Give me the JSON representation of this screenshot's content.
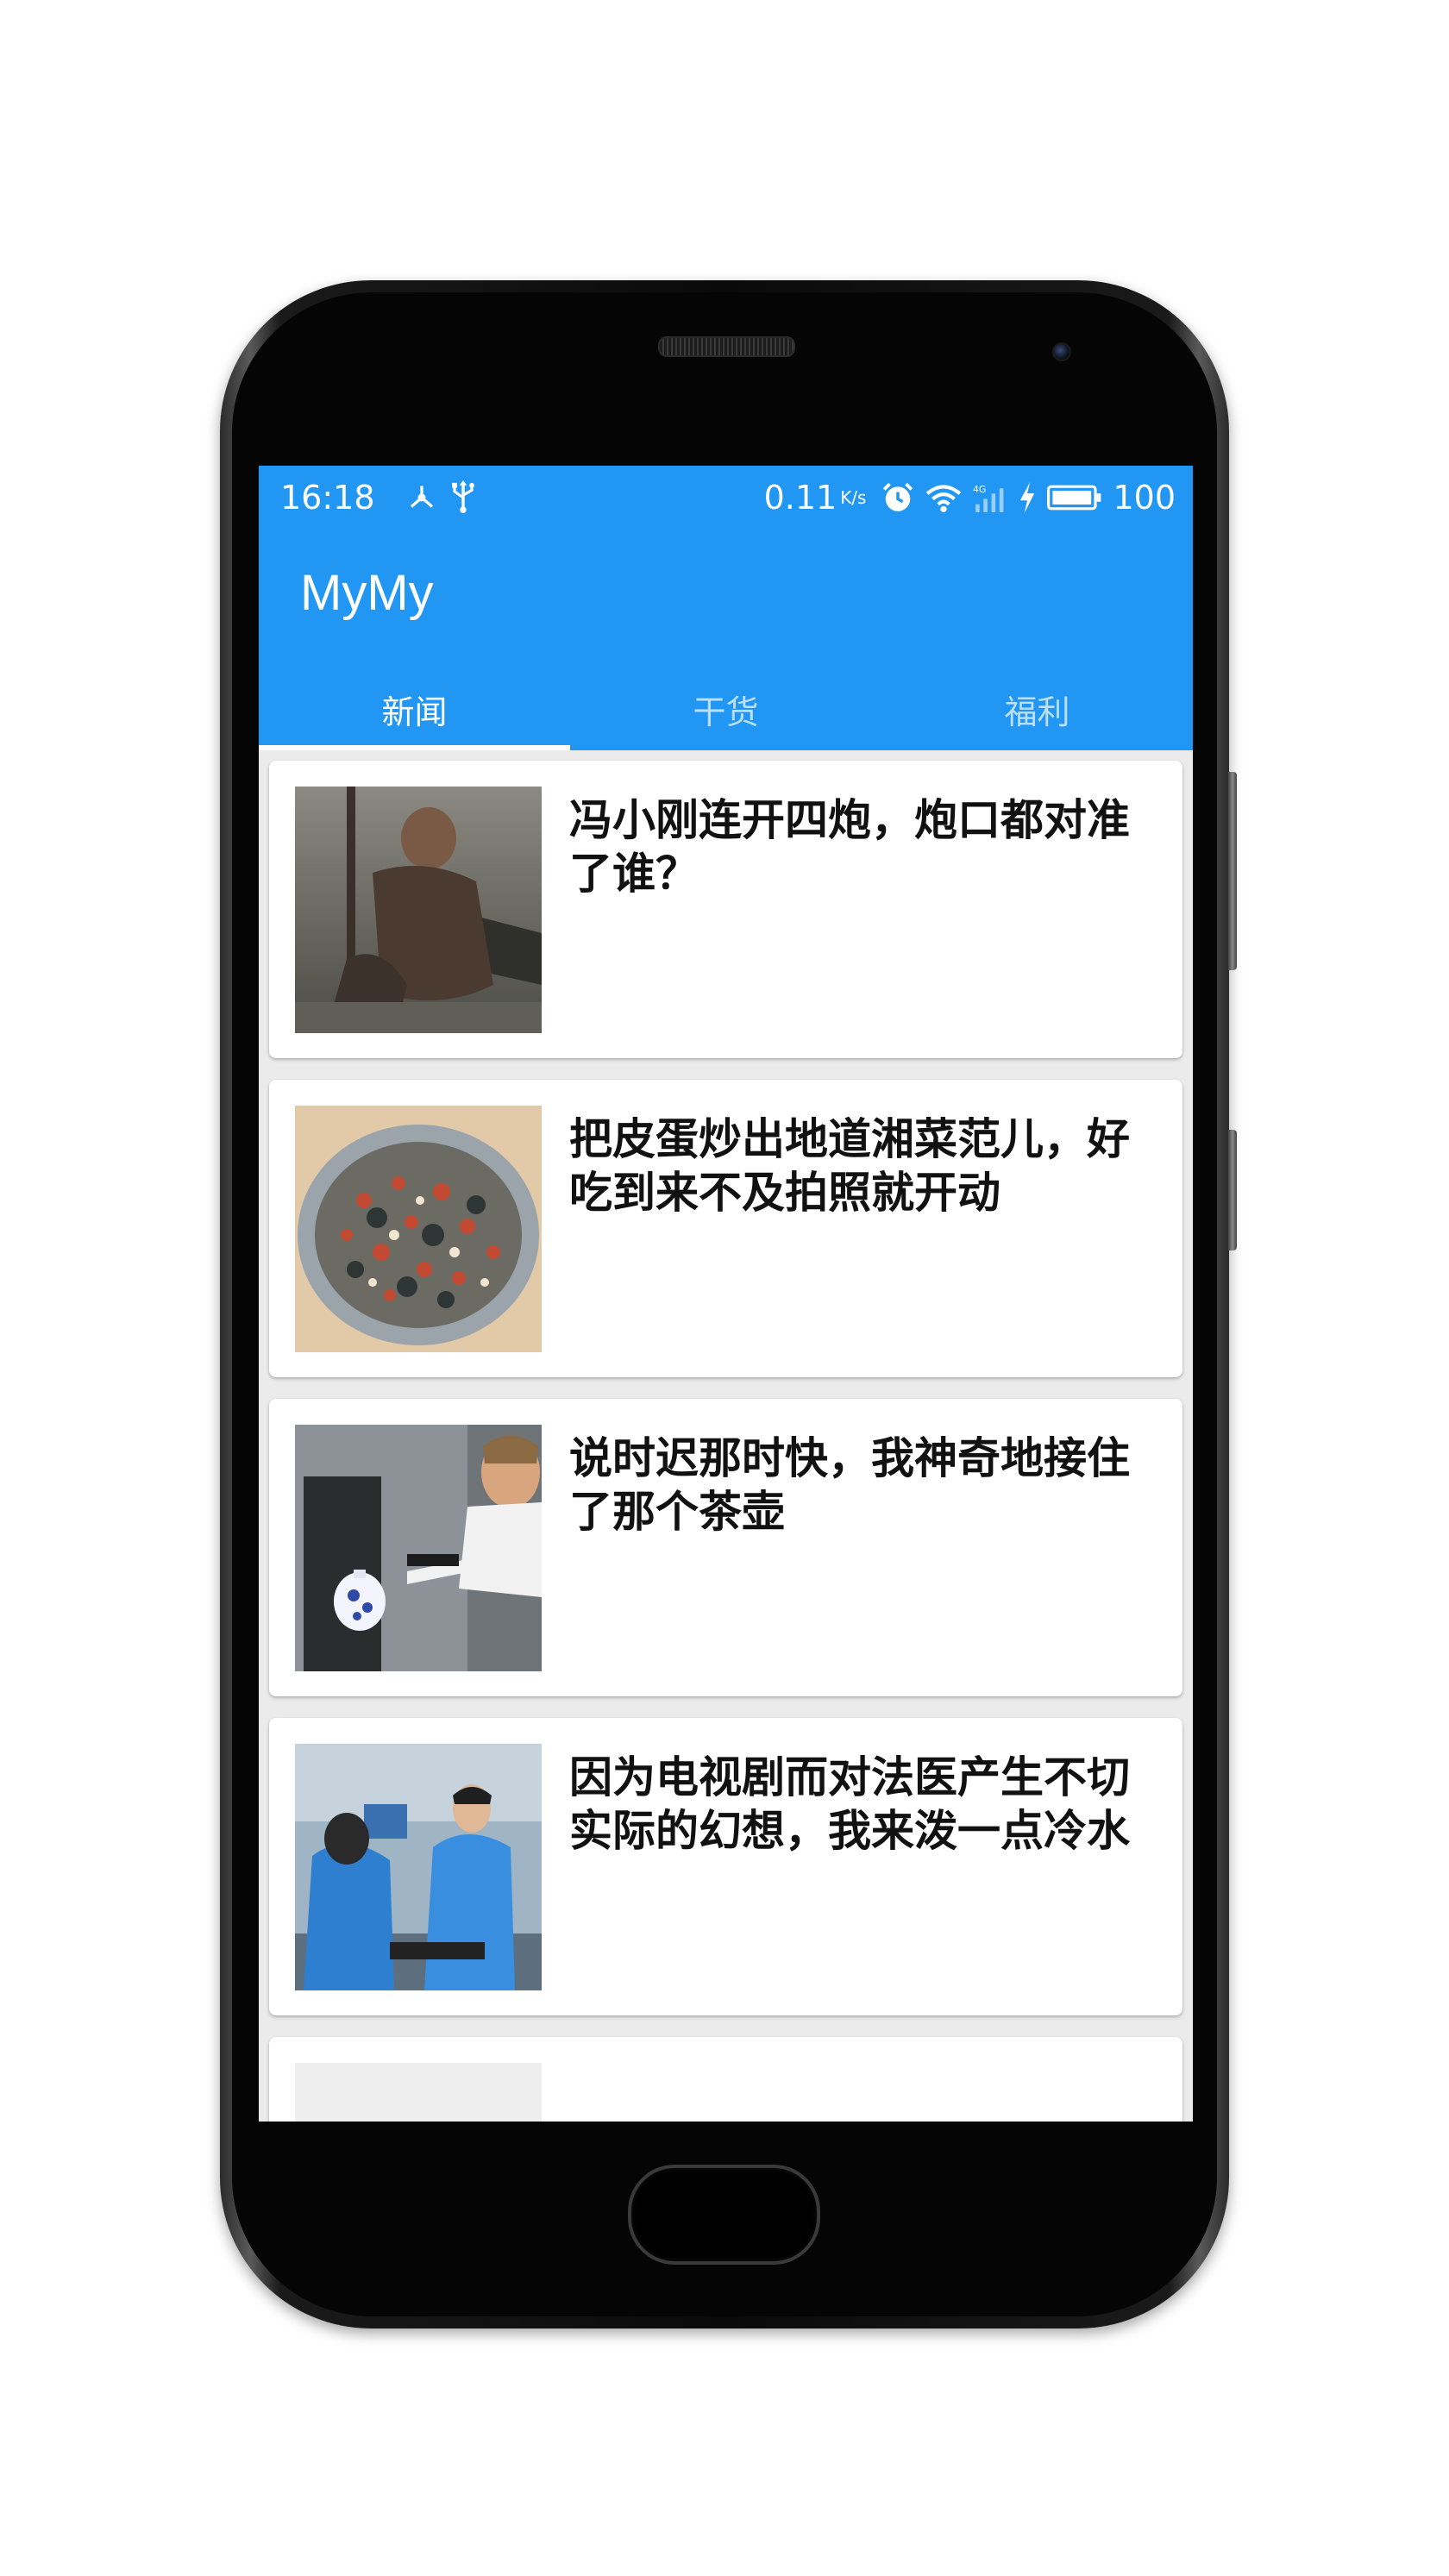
{
  "status_bar": {
    "time": "16:18",
    "net_speed": "0.11",
    "net_speed_unit": "K/s",
    "signal_label": "4G",
    "battery": "100"
  },
  "app_bar": {
    "title": "MyMy"
  },
  "tabs": [
    {
      "label": "新闻",
      "active": true
    },
    {
      "label": "干货",
      "active": false
    },
    {
      "label": "福利",
      "active": false
    }
  ],
  "news": [
    {
      "title": "冯小刚连开四炮，炮口都对准了谁？"
    },
    {
      "title": "把皮蛋炒出地道湘菜范儿，好吃到来不及拍照就开动"
    },
    {
      "title": "说时迟那时快，我神奇地接住了那个茶壶"
    },
    {
      "title": "因为电视剧而对法医产生不切实际的幻想，我来泼一点冷水"
    },
    {
      "title": ""
    }
  ],
  "colors": {
    "primary": "#2196f3",
    "card_bg": "#ffffff",
    "list_bg": "#ebebeb",
    "title_text": "#111111"
  }
}
